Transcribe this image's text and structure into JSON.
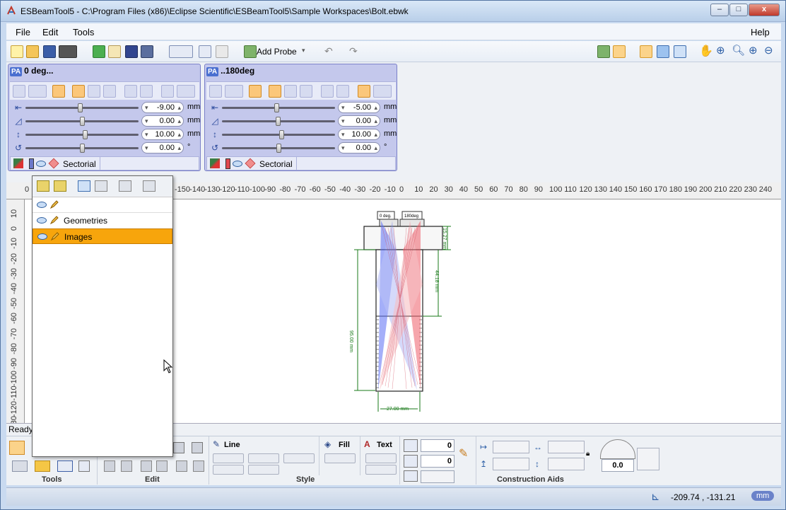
{
  "window": {
    "title": "ESBeamTool5 - C:\\Program Files (x86)\\Eclipse Scientific\\ESBeamTool5\\Sample Workspaces\\Bolt.ebwk",
    "min": "‒",
    "max": "□",
    "close": "x"
  },
  "menu": {
    "file": "File",
    "edit": "Edit",
    "tools": "Tools",
    "help": "Help"
  },
  "toolbar": {
    "add_probe": "Add Probe"
  },
  "probes": [
    {
      "badge": "PA",
      "name": "0 deg...",
      "color": "#6b78c9",
      "values": [
        "-9.00",
        "0.00",
        "10.00",
        "0.00"
      ],
      "units": [
        "mm",
        "mm",
        "mm",
        "°"
      ],
      "scan": "Sectorial"
    },
    {
      "badge": "PA",
      "name": "..180deg",
      "color": "#e0484e",
      "values": [
        "-5.00",
        "0.00",
        "10.00",
        "0.00"
      ],
      "units": [
        "mm",
        "mm",
        "mm",
        "°"
      ],
      "scan": "Sectorial"
    }
  ],
  "ruler": {
    "h_labels": [
      "0",
      "-150",
      "-140",
      "-130",
      "-120",
      "-110",
      "-100",
      "-90",
      "-80",
      "-70",
      "-60",
      "-50",
      "-40",
      "-30",
      "-20",
      "-10",
      "0",
      "10",
      "20",
      "30",
      "40",
      "50",
      "60",
      "70",
      "80",
      "90",
      "100",
      "110",
      "120",
      "130",
      "140",
      "150",
      "160",
      "170",
      "180",
      "190",
      "200",
      "210",
      "220",
      "230",
      "240"
    ],
    "v_labels": [
      "10",
      "0",
      "-10",
      "-20",
      "-30",
      "-40",
      "-50",
      "-60",
      "-70",
      "-80",
      "-90",
      "-100",
      "-110",
      "-120",
      "-130"
    ]
  },
  "drawing": {
    "probe1_label": "0 deg.",
    "probe2_label": "180deg",
    "dim_height": "95.00 mm",
    "dim_head": "15.27 mm",
    "dim_shank": "44.18 mm",
    "dim_width": "27.00 mm"
  },
  "layers": {
    "items": [
      {
        "label": "Geometries",
        "selected": false
      },
      {
        "label": "Images",
        "selected": true
      }
    ]
  },
  "status": {
    "ready": "Ready",
    "coords": "-209.74 , -131.21",
    "unit": "mm"
  },
  "bottom": {
    "line": "Line",
    "fill": "Fill",
    "text": "Text",
    "num1": "0",
    "num2": "0",
    "angle": "0.0",
    "groups": {
      "tools": "Tools",
      "edit": "Edit",
      "style": "Style",
      "construction": "Construction Aids"
    }
  }
}
